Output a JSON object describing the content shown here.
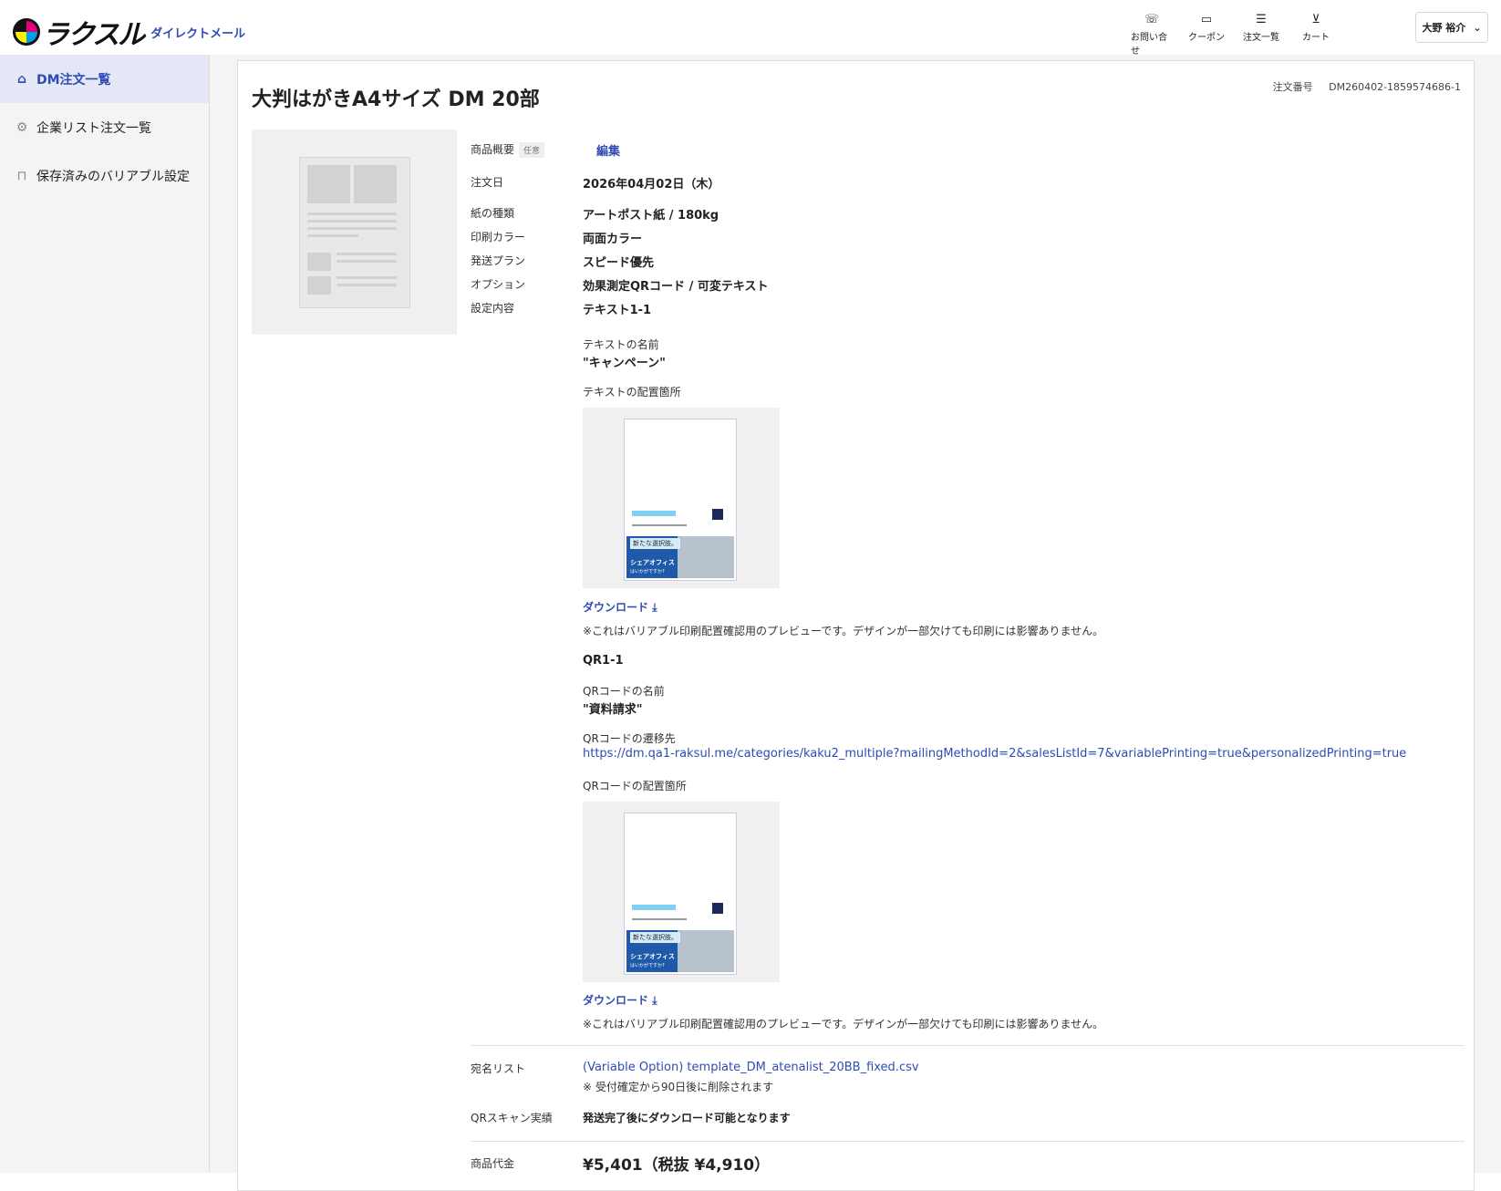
{
  "header": {
    "logo_text": "ラクスル",
    "logo_sub": "ダイレクトメール",
    "nav": [
      {
        "label": "お問い合せ",
        "icon": "phone-icon"
      },
      {
        "label": "クーポン",
        "icon": "coupon-icon"
      },
      {
        "label": "注文一覧",
        "icon": "list-icon"
      },
      {
        "label": "カート",
        "icon": "cart-icon"
      }
    ],
    "user": "大野 裕介"
  },
  "sidebar": {
    "items": [
      {
        "label": "DM注文一覧",
        "icon": "home-icon",
        "active": true
      },
      {
        "label": "企業リスト注文一覧",
        "icon": "gear-icon"
      },
      {
        "label": "保存済みのバリアブル設定",
        "icon": "bookmark-icon"
      }
    ]
  },
  "order": {
    "title": "大判はがきA4サイズ DM  20部",
    "order_no_label": "注文番号",
    "order_no": "DM260402-1859574686-1",
    "summary_label": "商品概要",
    "summary_tag": "任意",
    "edit_label": "編集",
    "rows": [
      {
        "label": "注文日",
        "value": "2026年04月02日（木）"
      },
      {
        "label": "紙の種類",
        "value": "アートポスト紙 / 180kg"
      },
      {
        "label": "印刷カラー",
        "value": "両面カラー"
      },
      {
        "label": "発送プラン",
        "value": "スピード優先"
      },
      {
        "label": "オプション",
        "value": "効果測定QRコード / 可変テキスト"
      },
      {
        "label": "設定内容",
        "value": "テキスト1-1"
      }
    ],
    "text_name_label": "テキストの名前",
    "text_name_value": "\"キャンペーン\"",
    "text_pos_label": "テキストの配置箇所",
    "download_label": "ダウンロード",
    "preview_note": "※これはバリアブル印刷配置確認用のプレビューです。デザインが一部欠けても印刷には影響ありません。",
    "qr_heading": "QR1-1",
    "qr_name_label": "QRコードの名前",
    "qr_name_value": "\"資料請求\"",
    "qr_dest_label": "QRコードの遷移先",
    "qr_dest_url": "https://dm.qa1-raksul.me/categories/kaku2_multiple?mailingMethodId=2&salesListId=7&variablePrinting=true&personalizedPrinting=true",
    "qr_pos_label": "QRコードの配置箇所",
    "list_label": "宛名リスト",
    "list_file": "(Variable Option) template_DM_atenalist_20BB_fixed.csv",
    "list_note": "※ 受付確定から90日後に削除されます",
    "scan_label": "QRスキャン実績",
    "scan_value": "発送完了後にダウンロード可能となります",
    "price_label": "商品代金",
    "price_value": "¥5,401（税抜 ¥4,910）"
  },
  "postcard": {
    "headline": "新たな選択肢。",
    "subhead": "シェアオフィス",
    "tagline": "はいかがですか?"
  }
}
